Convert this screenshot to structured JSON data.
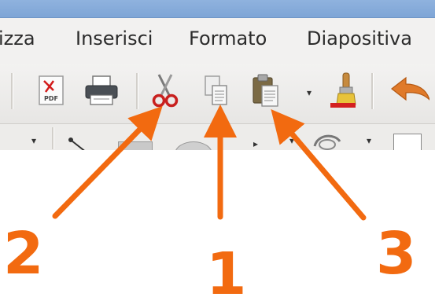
{
  "menu": {
    "items": [
      "izza",
      "Inserisci",
      "Formato",
      "Diapositiva"
    ]
  },
  "toolbar": {
    "pdf_icon_text": "PDF"
  },
  "callouts": {
    "one": "1",
    "two": "2",
    "three": "3"
  },
  "colors": {
    "arrow": "#f26a10",
    "titlebar": "#7ea5d6",
    "menubar": "#f2f1f0"
  },
  "icons": [
    "export-pdf-icon",
    "print-icon",
    "cut-icon",
    "copy-icon",
    "paste-icon",
    "clone-formatting-icon",
    "undo-icon"
  ]
}
